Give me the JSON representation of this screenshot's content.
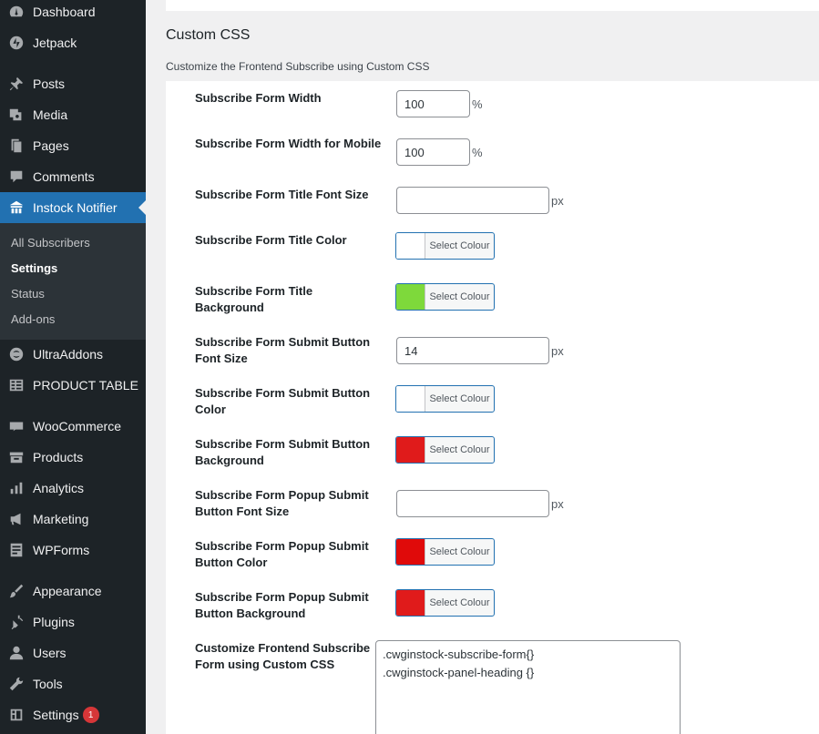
{
  "sidebar": {
    "items": [
      {
        "label": "Dashboard",
        "icon": "dashboard-icon"
      },
      {
        "label": "Jetpack",
        "icon": "jetpack-icon"
      },
      {
        "label": "Posts",
        "icon": "pin-icon"
      },
      {
        "label": "Media",
        "icon": "media-icon"
      },
      {
        "label": "Pages",
        "icon": "pages-icon"
      },
      {
        "label": "Comments",
        "icon": "comments-icon"
      },
      {
        "label": "Instock Notifier",
        "icon": "store-icon"
      },
      {
        "label": "UltraAddons",
        "icon": "ultraaddons-icon"
      },
      {
        "label": "PRODUCT TABLE",
        "icon": "table-icon"
      },
      {
        "label": "WooCommerce",
        "icon": "woo-icon"
      },
      {
        "label": "Products",
        "icon": "products-icon"
      },
      {
        "label": "Analytics",
        "icon": "analytics-icon"
      },
      {
        "label": "Marketing",
        "icon": "megaphone-icon"
      },
      {
        "label": "WPForms",
        "icon": "wpforms-icon"
      },
      {
        "label": "Appearance",
        "icon": "brush-icon"
      },
      {
        "label": "Plugins",
        "icon": "plugin-icon"
      },
      {
        "label": "Users",
        "icon": "user-icon"
      },
      {
        "label": "Tools",
        "icon": "wrench-icon"
      },
      {
        "label": "Settings",
        "icon": "settings-icon",
        "badge": "1"
      }
    ],
    "submenu": [
      "All Subscribers",
      "Settings",
      "Status",
      "Add-ons"
    ],
    "active_item": "Instock Notifier",
    "current_subitem": "Settings"
  },
  "section": {
    "title": "Custom CSS",
    "description": "Customize the Frontend Subscribe using Custom CSS"
  },
  "fields": {
    "form_width": {
      "label": "Subscribe Form Width",
      "value": "100",
      "unit": "%"
    },
    "form_width_mobile": {
      "label": "Subscribe Form Width for Mobile",
      "value": "100",
      "unit": "%"
    },
    "title_font_size": {
      "label": "Subscribe Form Title Font Size",
      "value": "",
      "unit": "px"
    },
    "title_color": {
      "label": "Subscribe Form Title Color",
      "button": "Select Colour",
      "color": "#ffffff"
    },
    "title_bg": {
      "label": "Subscribe Form Title Background",
      "button": "Select Colour",
      "color": "#7ed93b"
    },
    "submit_font_size": {
      "label": "Subscribe Form Submit Button Font Size",
      "value": "14",
      "unit": "px"
    },
    "submit_color": {
      "label": "Subscribe Form Submit Button Color",
      "button": "Select Colour",
      "color": "#ffffff"
    },
    "submit_bg": {
      "label": "Subscribe Form Submit Button Background",
      "button": "Select Colour",
      "color": "#e01b1b"
    },
    "popup_font_size": {
      "label": "Subscribe Form Popup Submit Button Font Size",
      "value": "",
      "unit": "px"
    },
    "popup_color": {
      "label": "Subscribe Form Popup Submit Button Color",
      "button": "Select Colour",
      "color": "#e00a0a"
    },
    "popup_bg": {
      "label": "Subscribe Form Popup Submit Button Background",
      "button": "Select Colour",
      "color": "#e01b1b"
    },
    "custom_css": {
      "label": "Customize Frontend Subscribe Form using Custom CSS",
      "line1": ".cwginstock-subscribe-form{}",
      "line2": ".cwginstock-panel-heading {}"
    }
  },
  "colors": {
    "sidebar_bg": "#1d2327",
    "accent": "#2271b1"
  }
}
